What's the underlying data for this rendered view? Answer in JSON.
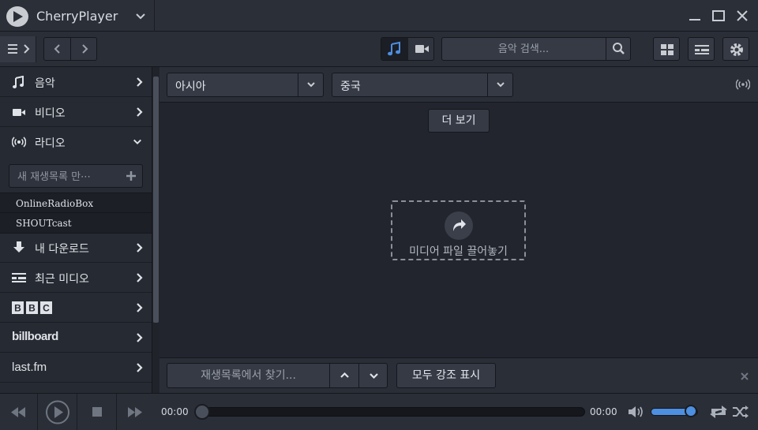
{
  "app": {
    "title": "CherryPlayer"
  },
  "toolbar": {
    "search_placeholder": "음악 검색...",
    "active_mode": "music"
  },
  "sidebar": {
    "items": [
      {
        "label": "음악",
        "icon": "music-note-icon",
        "expanded": false
      },
      {
        "label": "비디오",
        "icon": "video-camera-icon",
        "expanded": false
      },
      {
        "label": "라디오",
        "icon": "radio-broadcast-icon",
        "expanded": true
      },
      {
        "label": "내 다운로드",
        "icon": "download-arrow-icon",
        "expanded": false
      },
      {
        "label": "최근 미디오",
        "icon": "recent-media-icon",
        "expanded": false
      },
      {
        "label": "BBC",
        "icon": "bbc-logo",
        "expanded": false
      },
      {
        "label": "billboard",
        "icon": "billboard-logo",
        "expanded": false
      },
      {
        "label": "last.fm",
        "icon": "lastfm-logo",
        "expanded": false
      }
    ],
    "new_playlist_placeholder": "새 재생목록 만⋯",
    "radio_sources": [
      "OnlineRadioBox",
      "SHOUTcast"
    ]
  },
  "filters": {
    "region": "아시아",
    "country": "중국"
  },
  "main": {
    "more_label": "더 보기",
    "drop_label": "미디어 파일 끌어놓기"
  },
  "findbar": {
    "placeholder": "재생목록에서 찾기...",
    "highlight_label": "모두 강조 표시"
  },
  "player": {
    "elapsed": "00:00",
    "duration": "00:00",
    "progress": 0,
    "volume": 0.85
  },
  "colors": {
    "accent": "#4d8fe0",
    "background": "#22252d",
    "panel": "#2a2e37"
  }
}
